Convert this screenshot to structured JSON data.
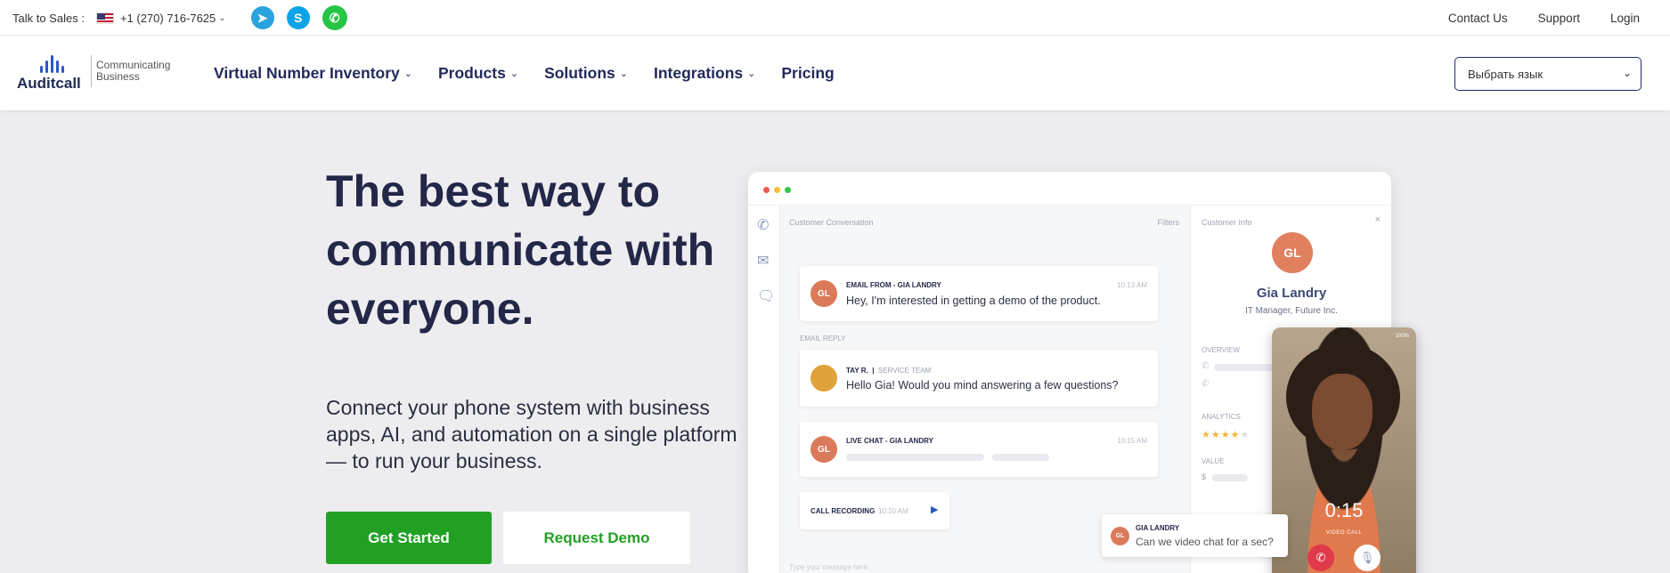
{
  "topbar": {
    "talk_label": "Talk to Sales :",
    "phone": "+1 (270) 716-7625",
    "social": [
      "telegram-icon",
      "skype-icon",
      "whatsapp-icon"
    ],
    "links": [
      "Contact Us",
      "Support",
      "Login"
    ]
  },
  "nav": {
    "logo_name": "Auditcall",
    "logo_tagline": "Communicating Business",
    "menu": [
      "Virtual Number Inventory",
      "Products",
      "Solutions",
      "Integrations",
      "Pricing"
    ],
    "language_select": "Выбрать язык"
  },
  "hero": {
    "title": "The best way to communicate with everyone.",
    "subtitle": "Connect your phone system with business apps, AI, and automation on a single platform — to run your business.",
    "primary_button": "Get Started",
    "secondary_button": "Request Demo"
  },
  "app_preview": {
    "conversation_header": "Customer Conversation",
    "filters_label": "Filters",
    "info_header": "Customer Info",
    "messages": [
      {
        "initials": "GL",
        "from": "EMAIL FROM - GIA LANDRY",
        "text": "Hey, I'm interested in getting a demo of the product.",
        "time": "10:13 AM"
      },
      {
        "section": "EMAIL REPLY",
        "name": "TAY R.",
        "role": "SERVICE TEAM",
        "text": "Hello Gia! Would you mind answering a few questions?"
      },
      {
        "initials": "GL",
        "from": "LIVE CHAT - GIA LANDRY",
        "time": "10:15 AM"
      },
      {
        "label": "CALL RECORDING",
        "time": "10:20 AM"
      }
    ],
    "input_placeholder": "Type your message here",
    "customer": {
      "initials": "GL",
      "name": "Gia Landry",
      "role": "IT Manager, Future Inc.",
      "sections": [
        "OVERVIEW",
        "ANALYTICS",
        "VALUE"
      ],
      "rating": 4,
      "value_symbol": "$"
    },
    "video_call": {
      "battery": "100%",
      "timer": "0:15",
      "label": "VIDEO CALL"
    },
    "chat_bubble": {
      "initials": "GL",
      "name": "GIA LANDRY",
      "text": "Can we video chat for a sec?"
    }
  },
  "colors": {
    "primary_green": "#21a024",
    "navy": "#232748",
    "avatar_orange": "#db7a5a"
  }
}
